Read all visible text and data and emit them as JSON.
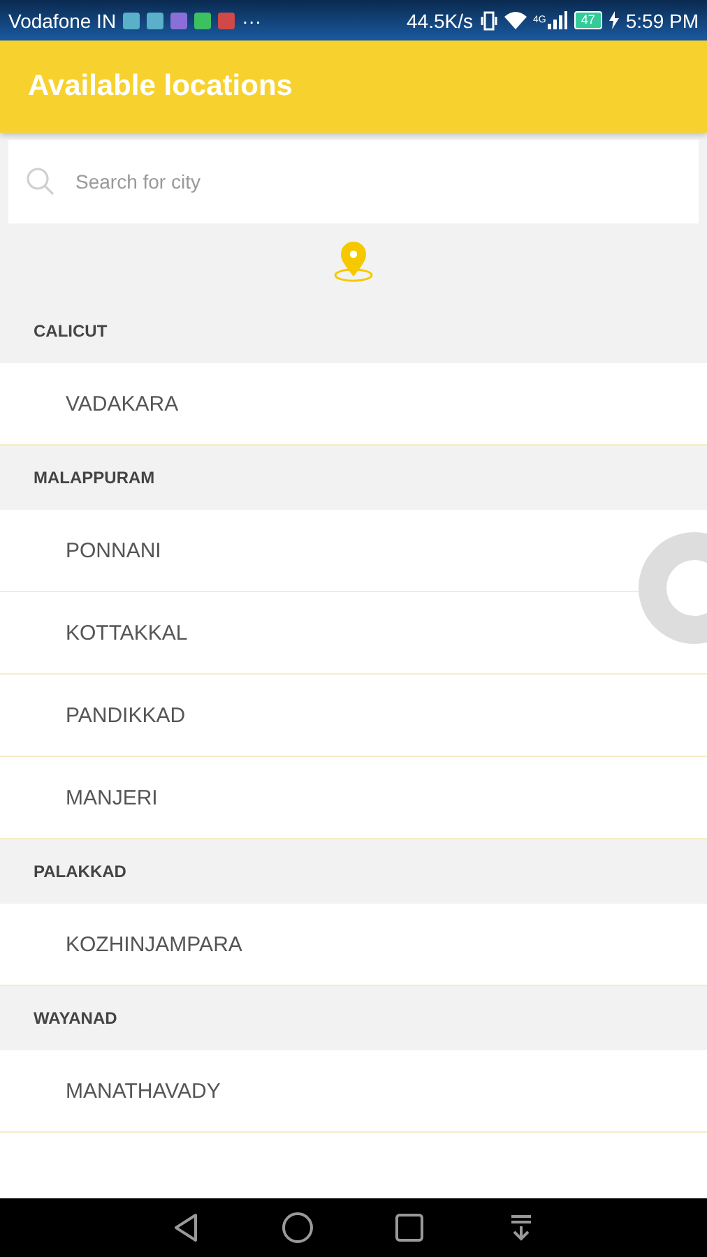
{
  "status_bar": {
    "carrier": "Vodafone IN",
    "more": "···",
    "speed": "44.5K/s",
    "network": "4G",
    "battery": "47",
    "time": "5:59 PM"
  },
  "app_bar": {
    "title": "Available locations"
  },
  "search": {
    "placeholder": "Search for city"
  },
  "sections": [
    {
      "title": "CALICUT",
      "items": [
        "VADAKARA"
      ]
    },
    {
      "title": "MALAPPURAM",
      "items": [
        "PONNANI",
        "KOTTAKKAL",
        "PANDIKKAD",
        "MANJERI"
      ]
    },
    {
      "title": "PALAKKAD",
      "items": [
        "KOZHINJAMPARA"
      ]
    },
    {
      "title": "WAYANAD",
      "items": [
        "MANATHAVADY"
      ]
    }
  ]
}
